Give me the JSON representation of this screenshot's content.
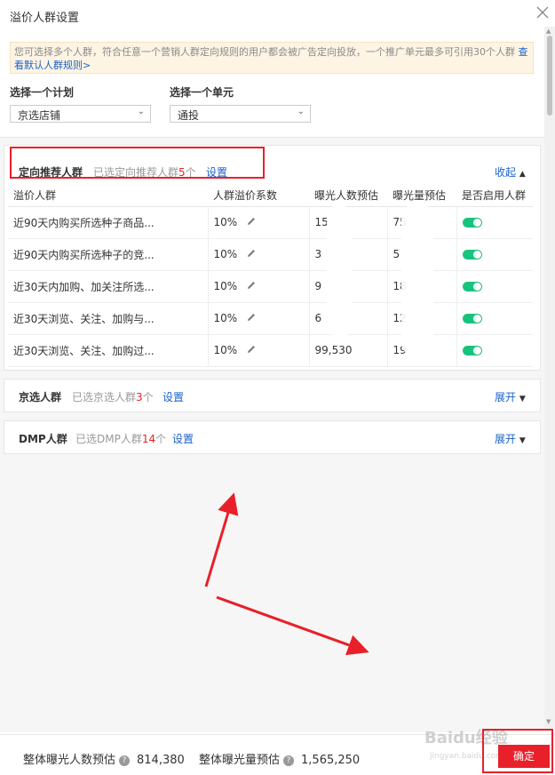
{
  "dialog": {
    "title": "溢价人群设置",
    "notice_text": "您可选择多个人群，符合任意一个营销人群定向规则的用户都会被广告定向投放，一个推广单元最多可引用30个人群",
    "notice_link": "查看默认人群规则>"
  },
  "selectors": {
    "plan_label": "选择一个计划",
    "plan_value": "京选店铺",
    "unit_label": "选择一个单元",
    "unit_value": "通投"
  },
  "recommended": {
    "title": "定向推荐人群",
    "info_prefix": "已选定向推荐人群",
    "count": "5",
    "info_suffix": "个",
    "set_label": "设置",
    "toggle_label": "收起",
    "columns": [
      "溢价人群",
      "人群溢价系数",
      "曝光人数预估",
      "曝光量预估",
      "是否启用人群"
    ],
    "rows": [
      {
        "name": "近90天内购买所选种子商品...",
        "rate": "10%",
        "people": "1",
        "people_tail": "5",
        "views": "",
        "views_tail": "75",
        "enabled": true
      },
      {
        "name": "近90天内购买所选种子的竞...",
        "rate": "10%",
        "people": "3",
        "people_tail": "",
        "views": "5",
        "views_tail": "",
        "enabled": true
      },
      {
        "name": "近30天内加购、加关注所选...",
        "rate": "10%",
        "people": "9",
        "people_tail": "",
        "views": "18",
        "views_tail": "",
        "enabled": true
      },
      {
        "name": "近30天浏览、关注、加购与...",
        "rate": "10%",
        "people": "6",
        "people_tail": "",
        "views": "12",
        "views_tail": "",
        "enabled": true
      },
      {
        "name": "近30天浏览、关注、加购过...",
        "rate": "10%",
        "people": "99,530",
        "people_tail": "",
        "views": "19",
        "views_tail": "",
        "enabled": true
      }
    ]
  },
  "jingxuan": {
    "title": "京选人群",
    "info_prefix": "已选京选人群",
    "count": "3",
    "info_suffix": "个",
    "set_label": "设置",
    "toggle_label": "展开"
  },
  "dmp": {
    "title": "DMP人群",
    "info_prefix": "已选DMP人群",
    "count": "14",
    "info_suffix": "个",
    "set_label": "设置",
    "toggle_label": "展开"
  },
  "footer": {
    "people_label": "整体曝光人数预估",
    "people_value": "814,380",
    "views_label": "整体曝光量预估",
    "views_value": "1,565,250",
    "confirm_label": "确定"
  },
  "watermark": {
    "main": "Baidu经验",
    "sub": "jingyan.baidu.com"
  },
  "colors": {
    "accent": "#1a62c9",
    "highlight": "#e8202a",
    "toggle_on": "#19c37d"
  }
}
